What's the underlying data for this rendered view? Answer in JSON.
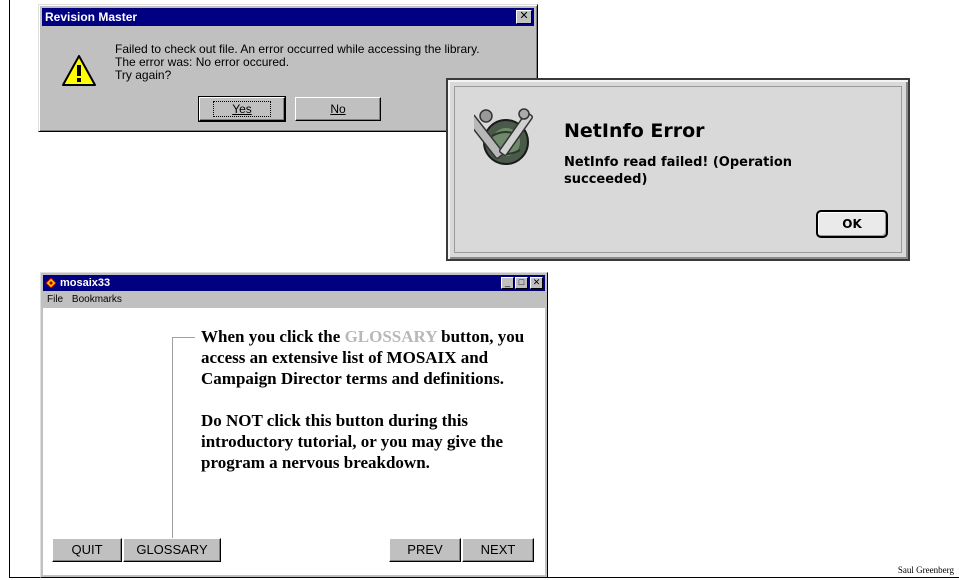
{
  "revision_dialog": {
    "title": "Revision Master",
    "close_glyph": "✕",
    "message_lines": [
      "Failed to check out file.  An error occurred while accessing the library.",
      "The error was:  No error occured.",
      "Try again?"
    ],
    "yes_label": "Yes",
    "no_label": "No",
    "icon": "warning-icon"
  },
  "netinfo_dialog": {
    "title": "NetInfo Error",
    "message": "NetInfo read failed! (Operation succeeded)",
    "ok_label": "OK",
    "icon": "tools-globe-icon"
  },
  "mosaix_window": {
    "title": "mosaix33",
    "controls": {
      "minimize": "_",
      "maximize": "□",
      "close": "✕"
    },
    "menu": [
      "File",
      "Bookmarks"
    ],
    "paragraph1": {
      "before": "When you click the ",
      "highlight": "GLOSSARY",
      "after": " button, you access an extensive list of MOSAIX and Campaign Director terms and definitions."
    },
    "paragraph2": "Do NOT click this button during this introductory tutorial, or you may give the program a nervous breakdown.",
    "buttons": {
      "quit": "QUIT",
      "glossary": "GLOSSARY",
      "prev": "PREV",
      "next": "NEXT"
    },
    "highlight_color": "#b8b8b8"
  },
  "credit": "Saul Greenberg",
  "colors": {
    "titlebar": "#000080",
    "face": "#c0c0c0",
    "mac_face": "#d9d9d9"
  }
}
